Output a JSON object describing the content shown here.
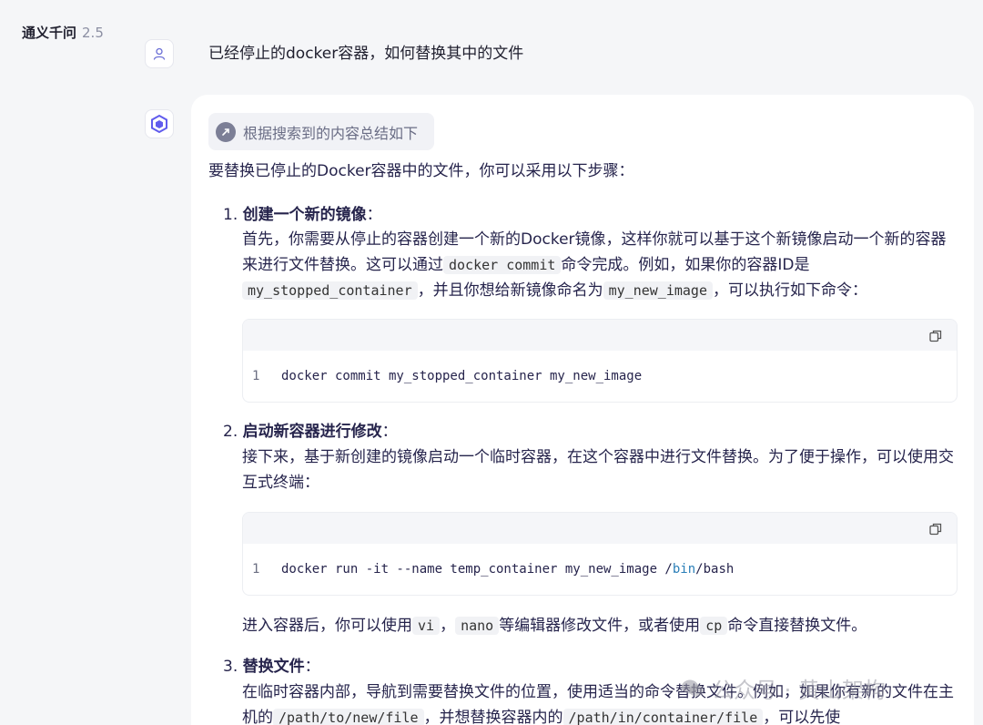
{
  "app": {
    "name": "通义千问",
    "version": "2.5"
  },
  "user": {
    "question": "已经停止的docker容器，如何替换其中的文件"
  },
  "answer": {
    "search_note": "根据搜索到的内容总结如下",
    "intro": "要替换已停止的Docker容器中的文件，你可以采用以下步骤：",
    "steps": [
      {
        "number": "1.",
        "title": "创建一个新的镜像",
        "colon": "：",
        "paragraph": {
          "t1": "首先，你需要从停止的容器创建一个新的Docker镜像，这样你就可以基于这个新镜像启动一个新的容器来进行文件替换。这可以通过",
          "c1": "docker commit",
          "t2": "命令完成。例如，如果你的容器ID是",
          "c2": "my_stopped_container",
          "t3": "，并且你想给新镜像命名为",
          "c3": "my_new_image",
          "t4": "，可以执行如下命令："
        },
        "code": {
          "line_no": "1",
          "text": "docker commit my_stopped_container my_new_image"
        }
      },
      {
        "number": "2.",
        "title": "启动新容器进行修改",
        "colon": "：",
        "paragraph": {
          "t1": "接下来，基于新创建的镜像启动一个临时容器，在这个容器中进行文件替换。为了便于操作，可以使用交互式终端："
        },
        "code": {
          "line_no": "1",
          "pre": "docker run -it --name temp_container my_new_image /",
          "blue": "bin",
          "post": "/bash"
        },
        "after": {
          "t1": "进入容器后，你可以使用",
          "c1": "vi",
          "t2": "，",
          "c2": "nano",
          "t3": "等编辑器修改文件，或者使用",
          "c3": "cp",
          "t4": "命令直接替换文件。"
        }
      },
      {
        "number": "3.",
        "title": "替换文件",
        "colon": "：",
        "paragraph": {
          "t1": "在临时容器内部，导航到需要替换文件的位置，使用适当的命令替换文件。例如，如果你有新的文件在主机的",
          "c1": "/path/to/new/file",
          "t2": "，并想替换容器内的",
          "c2": "/path/in/container/file",
          "t3": "，可以先使"
        }
      }
    ]
  },
  "watermark": "公众号 · 黄山架构"
}
